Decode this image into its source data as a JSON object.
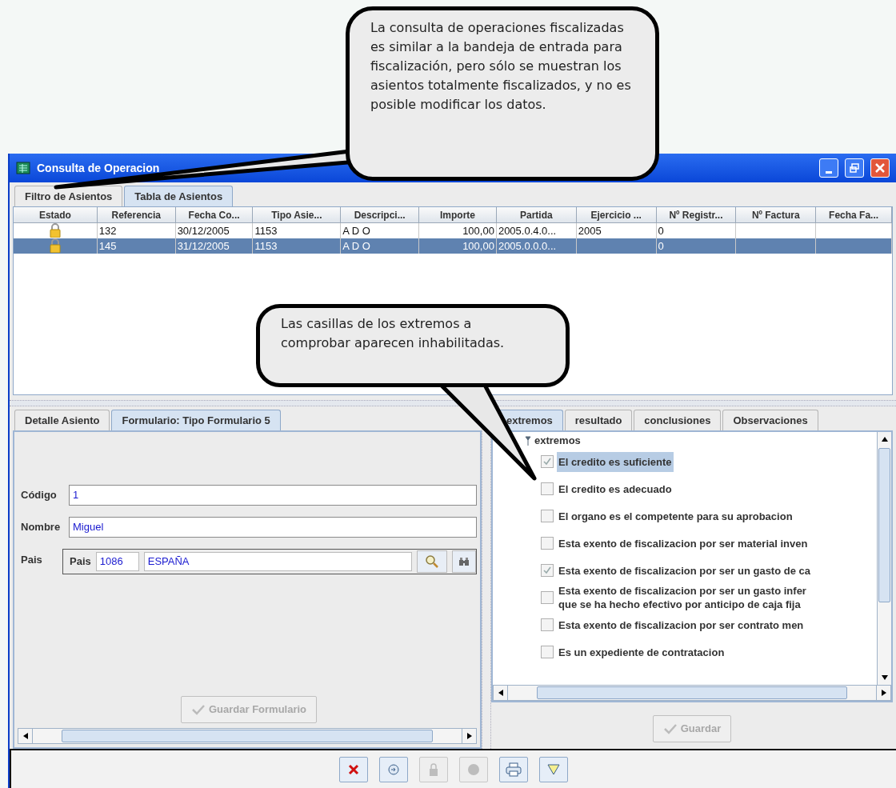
{
  "callouts": [
    {
      "text": "La consulta de operaciones fiscalizadas es similar a la bandeja de entrada para fiscalización, pero sólo se muestran los asientos totalmente fiscalizados, y no es posible modificar los datos."
    },
    {
      "text": "Las casillas de los extremos a comprobar aparecen inhabilitadas."
    }
  ],
  "window": {
    "title": "Consulta de Operacion"
  },
  "top_tabs": [
    {
      "label": "Filtro de Asientos",
      "selected": false
    },
    {
      "label": "Tabla de Asientos",
      "selected": true
    }
  ],
  "table": {
    "columns": [
      "Estado",
      "Referencia",
      "Fecha Co...",
      "Tipo Asie...",
      "Descripci...",
      "Importe",
      "Partida",
      "Ejercicio ...",
      "Nº Registr...",
      "Nº Factura",
      "Fecha Fa..."
    ],
    "rows": [
      {
        "selected": false,
        "locked": true,
        "cells": [
          null,
          "132",
          "30/12/2005",
          "1153",
          "A D O",
          "100,00",
          "2005.0.4.0...",
          "2005",
          "0"
        ]
      },
      {
        "selected": true,
        "locked": true,
        "cells": [
          null,
          "145",
          "31/12/2005",
          "1153",
          "A D O",
          "100,00",
          "2005.0.0.0...",
          null,
          "0"
        ]
      }
    ]
  },
  "detail_tabs": [
    {
      "label": "Detalle Asiento",
      "selected": false
    },
    {
      "label": "Formulario: Tipo Formulario 5",
      "selected": true
    }
  ],
  "form": {
    "fields": [
      {
        "label": "Código",
        "value": "1"
      },
      {
        "label": "Nombre",
        "value": "Miguel"
      }
    ],
    "pais": {
      "label": "Pais",
      "inner_label": "Pais",
      "code": "1086",
      "name": "ESPAÑA"
    },
    "save_button": {
      "label": "Guardar Formulario",
      "disabled": true
    }
  },
  "check_tabs": [
    {
      "label": "extremos",
      "selected": true
    },
    {
      "label": "resultado",
      "selected": false
    },
    {
      "label": "conclusiones",
      "selected": false
    },
    {
      "label": "Observaciones",
      "selected": false
    }
  ],
  "tree": {
    "root": "extremos",
    "expanded": true,
    "items": [
      {
        "lines": [
          "El credito es suficiente"
        ],
        "checked": true,
        "selected": true,
        "disabled": true
      },
      {
        "lines": [
          "El credito es adecuado"
        ],
        "checked": false,
        "selected": false,
        "disabled": true
      },
      {
        "lines": [
          "El organo es el competente para su aprobacion"
        ],
        "checked": false,
        "selected": false,
        "disabled": true
      },
      {
        "lines": [
          "Esta exento de fiscalizacion por ser material inven"
        ],
        "checked": false,
        "selected": false,
        "disabled": true
      },
      {
        "lines": [
          "Esta exento de fiscalizacion por ser un gasto de ca"
        ],
        "checked": true,
        "selected": false,
        "disabled": true
      },
      {
        "lines": [
          "Esta exento de fiscalizacion por ser un gasto infer",
          "que se ha hecho efectivo por anticipo de caja fija"
        ],
        "checked": false,
        "selected": false,
        "disabled": true
      },
      {
        "lines": [
          "Esta exento de fiscalizacion por ser contrato men"
        ],
        "checked": false,
        "selected": false,
        "disabled": true
      },
      {
        "lines": [
          "Es un expediente de contratacion"
        ],
        "checked": false,
        "selected": false,
        "disabled": true
      }
    ]
  },
  "check_save_button": {
    "label": "Guardar",
    "disabled": true
  },
  "toolbar": [
    {
      "kind": "cancel",
      "disabled": false
    },
    {
      "kind": "refresh",
      "disabled": false
    },
    {
      "kind": "lock",
      "disabled": true
    },
    {
      "kind": "record",
      "disabled": true
    },
    {
      "kind": "print",
      "disabled": false
    },
    {
      "kind": "filter",
      "disabled": false
    }
  ]
}
